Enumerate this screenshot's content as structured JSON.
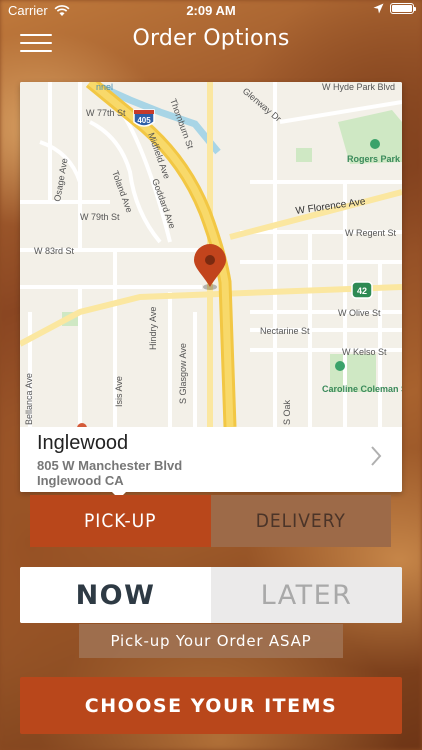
{
  "status_bar": {
    "carrier": "Carrier",
    "time": "2:09 AM"
  },
  "nav": {
    "title": "Order Options"
  },
  "map": {
    "labels": {
      "interstate": "405",
      "state_route": "42",
      "w_hyde_park": "W Hyde Park Blvd",
      "glenway": "Glenway Dr",
      "thornburn": "Thornburn St",
      "rogers_park": "Rogers Park",
      "w_77th": "W 77th St",
      "toland": "Toland Ave",
      "midfield": "Midfield Ave",
      "goddard": "Goddard Ave",
      "osage": "Osage Ave",
      "w_79th": "W 79th St",
      "w_florence": "W Florence Ave",
      "w_regent": "W Regent St",
      "w_83rd": "W 83rd St",
      "w_olive": "W Olive St",
      "nectarine": "Nectarine St",
      "w_kelso": "W Kelso St",
      "hindry": "Hindry Ave",
      "s_glasgow": "S Glasgow Ave",
      "isis": "Isis Ave",
      "bellanca": "Bellanca Ave",
      "caroline_coleman": "Caroline Coleman Stadium",
      "s_oak": "S Oak",
      "channel": "nnel"
    }
  },
  "location": {
    "name": "Inglewood",
    "address_line1": "805 W Manchester Blvd",
    "address_line2": "Inglewood CA"
  },
  "order_type": {
    "pickup_label": "PICK-UP",
    "delivery_label": "DELIVERY",
    "selected": "pickup"
  },
  "timing": {
    "now_label": "NOW",
    "later_label": "LATER",
    "selected": "now",
    "info_text": "Pick-up Your Order ASAP"
  },
  "cta": {
    "label": "CHOOSE YOUR ITEMS"
  },
  "colors": {
    "accent": "#b9471b",
    "inactive_segment": "#9d6a48",
    "highway_yellow": "#f5d35c",
    "map_pin": "#c2441c"
  }
}
